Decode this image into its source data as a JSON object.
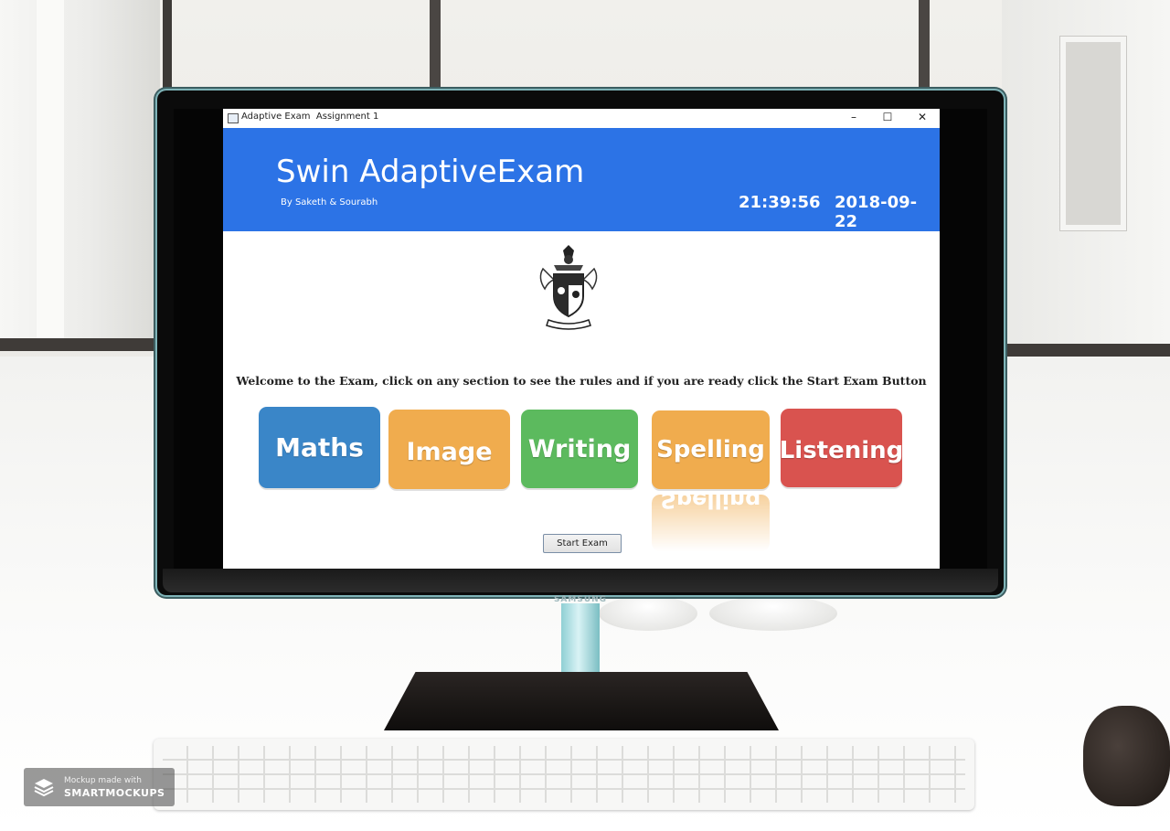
{
  "window": {
    "title": "Adaptive Exam  Assignment 1",
    "minimize_glyph": "–",
    "maximize_glyph": "☐",
    "close_glyph": "✕"
  },
  "header": {
    "app_title": "Swin AdaptiveExam",
    "subtitle": "By Saketh & Sourabh",
    "time": "21:39:56",
    "date": "2018-09-22",
    "band_color": "#2c73e6"
  },
  "welcome_text": "Welcome to the Exam, click on any section to see the rules and if you are ready click the Start Exam Button",
  "sections": [
    {
      "label": "Maths",
      "color": "#3a86c8"
    },
    {
      "label": "Image",
      "color": "#f0ac4e"
    },
    {
      "label": "Writing",
      "color": "#5cba5e"
    },
    {
      "label": "Spelling",
      "color": "#f0ac4e"
    },
    {
      "label": "Listening",
      "color": "#d9534f"
    }
  ],
  "start_button": {
    "label": "Start Exam"
  },
  "monitor_brand": "SAMSUNG",
  "mockup_badge": {
    "line1": "Mockup made with",
    "line2": "SMARTMOCKUPS"
  }
}
